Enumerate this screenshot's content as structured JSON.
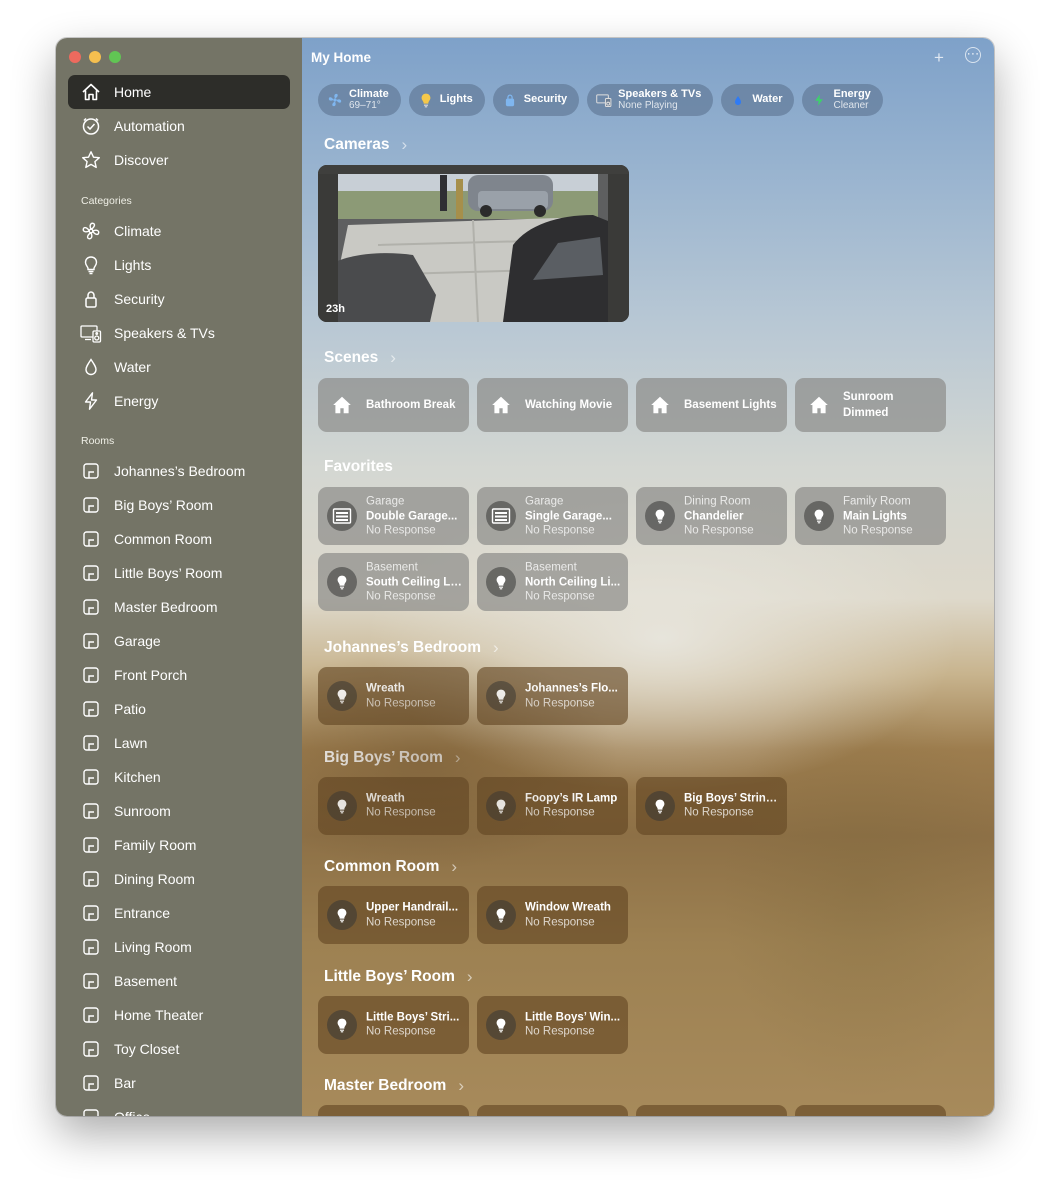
{
  "window": {
    "title": "My Home"
  },
  "sidebar": {
    "main_items": [
      {
        "label": "Home",
        "icon": "house-icon",
        "active": true
      },
      {
        "label": "Automation",
        "icon": "clock-check-icon"
      },
      {
        "label": "Discover",
        "icon": "star-icon"
      }
    ],
    "categories_header": "Categories",
    "categories": [
      {
        "label": "Climate",
        "icon": "fan-icon"
      },
      {
        "label": "Lights",
        "icon": "lightbulb-icon"
      },
      {
        "label": "Security",
        "icon": "lock-icon"
      },
      {
        "label": "Speakers & TVs",
        "icon": "tv-speaker-icon"
      },
      {
        "label": "Water",
        "icon": "drop-icon"
      },
      {
        "label": "Energy",
        "icon": "bolt-icon"
      }
    ],
    "rooms_header": "Rooms",
    "rooms": [
      "Johannes’s Bedroom",
      "Big Boys’ Room",
      "Common Room",
      "Little Boys’ Room",
      "Master Bedroom",
      "Garage",
      "Front Porch",
      "Patio",
      "Lawn",
      "Kitchen",
      "Sunroom",
      "Family Room",
      "Dining Room",
      "Entrance",
      "Living Room",
      "Basement",
      "Home Theater",
      "Toy Closet",
      "Bar",
      "Office"
    ]
  },
  "toolbar": {
    "add_label": "+",
    "more_label": "⋯"
  },
  "status_chips": [
    {
      "title": "Climate",
      "subtitle": "69–71°",
      "icon": "fan-icon"
    },
    {
      "title": "Lights",
      "subtitle": "",
      "icon": "lightbulb-icon"
    },
    {
      "title": "Security",
      "subtitle": "",
      "icon": "lock-icon"
    },
    {
      "title": "Speakers & TVs",
      "subtitle": "None Playing",
      "icon": "tv-speaker-icon"
    },
    {
      "title": "Water",
      "subtitle": "",
      "icon": "drop-icon"
    },
    {
      "title": "Energy",
      "subtitle": "Cleaner",
      "icon": "bolt-icon"
    }
  ],
  "cameras": {
    "title": "Cameras",
    "items": [
      {
        "age": "23h"
      }
    ]
  },
  "scenes": {
    "title": "Scenes",
    "items": [
      "Bathroom Break",
      "Watching Movie",
      "Basement Lights",
      "Sunroom Dimmed"
    ]
  },
  "favorites": {
    "title": "Favorites",
    "items": [
      {
        "room": "Garage",
        "name": "Double Garage...",
        "status": "No Response",
        "icon": "garage-door-icon"
      },
      {
        "room": "Garage",
        "name": "Single Garage...",
        "status": "No Response",
        "icon": "garage-door-icon"
      },
      {
        "room": "Dining Room",
        "name": "Chandelier",
        "status": "No Response",
        "icon": "lightbulb-icon"
      },
      {
        "room": "Family Room",
        "name": "Main Lights",
        "status": "No Response",
        "icon": "lightbulb-icon"
      },
      {
        "room": "Basement",
        "name": "South Ceiling Li...",
        "status": "No Response",
        "icon": "lightbulb-icon"
      },
      {
        "room": "Basement",
        "name": "North Ceiling Li...",
        "status": "No Response",
        "icon": "lightbulb-icon"
      }
    ]
  },
  "room_sections": [
    {
      "title": "Johannes’s Bedroom",
      "items": [
        {
          "name": "Wreath",
          "status": "No Response"
        },
        {
          "name": "Johannes’s Flo...",
          "status": "No Response"
        }
      ]
    },
    {
      "title": "Big Boys’ Room",
      "items": [
        {
          "name": "Wreath",
          "status": "No Response"
        },
        {
          "name": "Foopy’s IR Lamp",
          "status": "No Response"
        },
        {
          "name": "Big Boys’ String...",
          "status": "No Response"
        }
      ]
    },
    {
      "title": "Common Room",
      "items": [
        {
          "name": "Upper Handrail...",
          "status": "No Response"
        },
        {
          "name": "Window Wreath",
          "status": "No Response"
        }
      ]
    },
    {
      "title": "Little Boys’ Room",
      "items": [
        {
          "name": "Little Boys’ Stri...",
          "status": "No Response"
        },
        {
          "name": "Little Boys’ Win...",
          "status": "No Response"
        }
      ]
    },
    {
      "title": "Master Bedroom",
      "items": []
    }
  ],
  "colors": {
    "sidebar_bg": "#747466",
    "active_item_bg": "#2d2d29",
    "bulb_active": "#f5c84a",
    "climate_blue": "#7fb6ef",
    "water_blue": "#2f7bf5",
    "energy_green": "#3dd16a"
  }
}
